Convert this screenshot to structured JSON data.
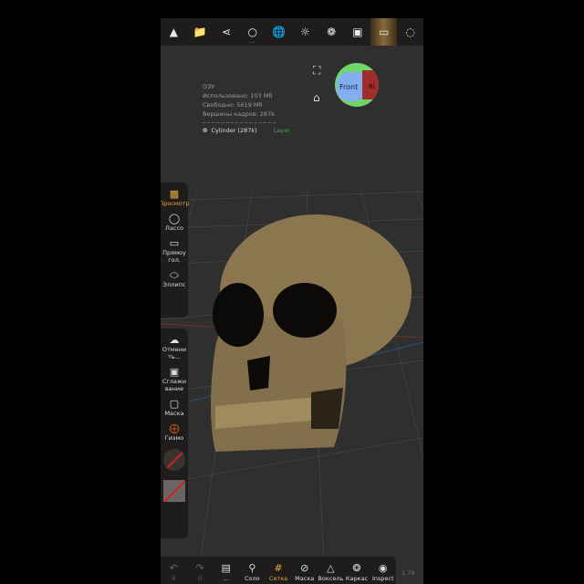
{
  "toolbar": {
    "icons": [
      "hat-icon",
      "folder-icon",
      "share-icon",
      "objects-icon",
      "sphere-grid-icon",
      "sun-icon",
      "material-icon",
      "image-icon",
      "camera-frame-icon",
      "selection-circle-icon"
    ],
    "more": "..."
  },
  "info": {
    "title": "ОЗУ",
    "used": "Использовано:  103 Мб",
    "free": "Свободно:  5619 Мб",
    "vertices": "Вершины кадров:  287k",
    "mesh": "Cylinder (287k)",
    "layer": "Layer"
  },
  "gizmo": {
    "front": "Front",
    "right": "Ri"
  },
  "left_tools": [
    {
      "label": "Просмотр",
      "icon": "camera-icon",
      "active": true
    },
    {
      "label": "Лассо",
      "icon": "lasso-icon"
    },
    {
      "label": "Прямоу гол.",
      "icon": "rectangle-icon"
    },
    {
      "label": "Эллипс",
      "icon": "ellipse-icon"
    }
  ],
  "left_tools2": [
    {
      "label": "Отмени ть...",
      "icon": "cloud-icon"
    },
    {
      "label": "Сглажи вание",
      "icon": "smooth-icon"
    },
    {
      "label": "Маска",
      "icon": "mask-icon"
    },
    {
      "label": "Гизмо",
      "icon": "gizmo-icon"
    }
  ],
  "bottom": [
    {
      "label": "0",
      "icon": "undo-icon",
      "dim": true
    },
    {
      "label": "0",
      "icon": "redo-icon",
      "dim": true
    },
    {
      "label": "...",
      "icon": "book-icon"
    },
    {
      "label": "Соло",
      "icon": "search-icon"
    },
    {
      "label": "Сетка",
      "icon": "grid-icon",
      "active": true
    },
    {
      "label": "Маска",
      "icon": "eye-off-icon"
    },
    {
      "label": "Воксель",
      "icon": "voxel-icon"
    },
    {
      "label": "Каркас",
      "icon": "wireframe-icon"
    },
    {
      "label": "Inspect",
      "icon": "inspect-icon"
    }
  ],
  "zoom_readout": "1.79",
  "colors": {
    "accent": "#e0a93a",
    "layer": "#47a544",
    "skull": "#8b7650"
  }
}
